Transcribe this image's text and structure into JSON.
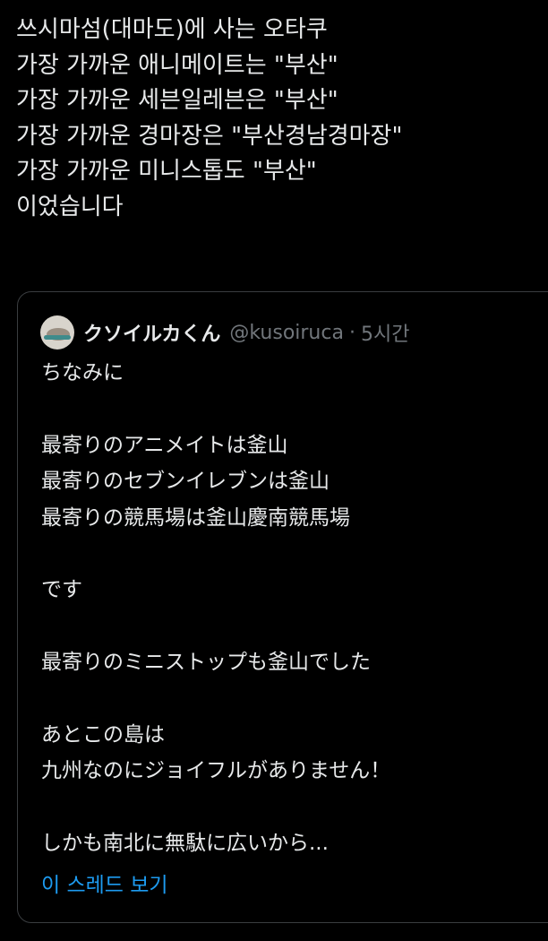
{
  "tweet": {
    "lines": [
      "쓰시마섬(대마도)에 사는 오타쿠",
      "가장 가까운 애니메이트는 \"부산\"",
      "가장 가까운 세븐일레븐은 \"부산\"",
      "가장 가까운 경마장은 \"부산경남경마장\"",
      "가장 가까운 미니스톱도 \"부산\"",
      "이었습니다"
    ]
  },
  "quoted": {
    "author_name": "クソイルカくん",
    "author_handle": "@kusoiruca",
    "separator": "·",
    "timestamp": "5시간",
    "lines": [
      "ちなみに",
      "",
      "最寄りのアニメイトは釜山",
      "最寄りのセブンイレブンは釜山",
      "最寄りの競馬場は釜山慶南競馬場",
      "",
      "です",
      "",
      "最寄りのミニストップも釜山でした",
      "",
      "あとこの島は",
      "九州なのにジョイフルがありません！",
      "",
      "しかも南北に無駄に広いから..."
    ],
    "thread_link": "이 스레드 보기"
  },
  "colors": {
    "background": "#000000",
    "text": "#e7e9ea",
    "secondary": "#71767b",
    "link": "#1d9bf0",
    "border": "#3a3d40"
  },
  "icons": {
    "avatar": "avatar-image"
  }
}
